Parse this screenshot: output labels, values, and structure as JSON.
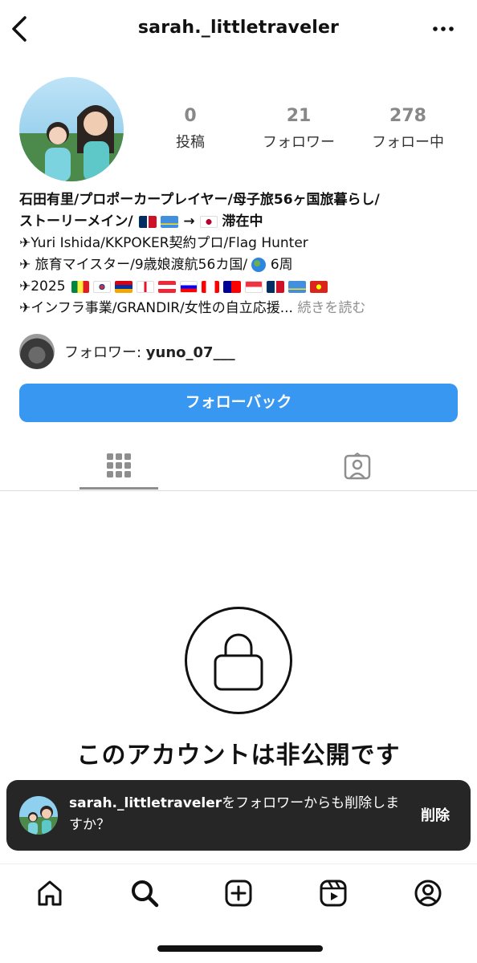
{
  "header": {
    "username": "sarah._littletraveler",
    "back_icon": "chevron-left-icon",
    "more_icon": "more-horizontal-icon"
  },
  "stats": {
    "posts": {
      "value": "0",
      "label": "投稿"
    },
    "followers": {
      "value": "21",
      "label": "フォロワー"
    },
    "following": {
      "value": "278",
      "label": "フォロー中"
    }
  },
  "bio": {
    "name_line1": "石田有里/プロポーカープレイヤー/母子旅56ヶ国旅暮らし/",
    "name_line2a": "ストーリーメイン/",
    "name_line2b": "→",
    "name_line2c": "滞在中",
    "line3": "✈Yuri Ishida/KKPOKER契約プロ/Flag Hunter",
    "line4a": "✈ 旅育マイスター/9歳娘渡航56カ国/",
    "line4b": "6周",
    "line5": "✈2025",
    "line6": "✈インフラ事業/GRANDIR/女性の自立応援...",
    "more_link": "続きを読む"
  },
  "mutual": {
    "label": "フォロワー: ",
    "username": "yuno_07___"
  },
  "follow_back_label": "フォローバック",
  "tabs": {
    "grid_icon": "grid-icon",
    "tagged_icon": "tagged-person-icon"
  },
  "private": {
    "lock_icon": "lock-icon",
    "title": "このアカウントは非公開です"
  },
  "toast": {
    "username": "sarah._littletraveler",
    "message": "をフォロワーからも削除しますか？",
    "action": "削除"
  },
  "bottom_nav": [
    "home-icon",
    "search-icon",
    "create-icon",
    "reels-icon",
    "profile-icon"
  ],
  "colors": {
    "accent": "#3897f0",
    "toast_bg": "#262626",
    "muted": "#8e8e8e"
  }
}
